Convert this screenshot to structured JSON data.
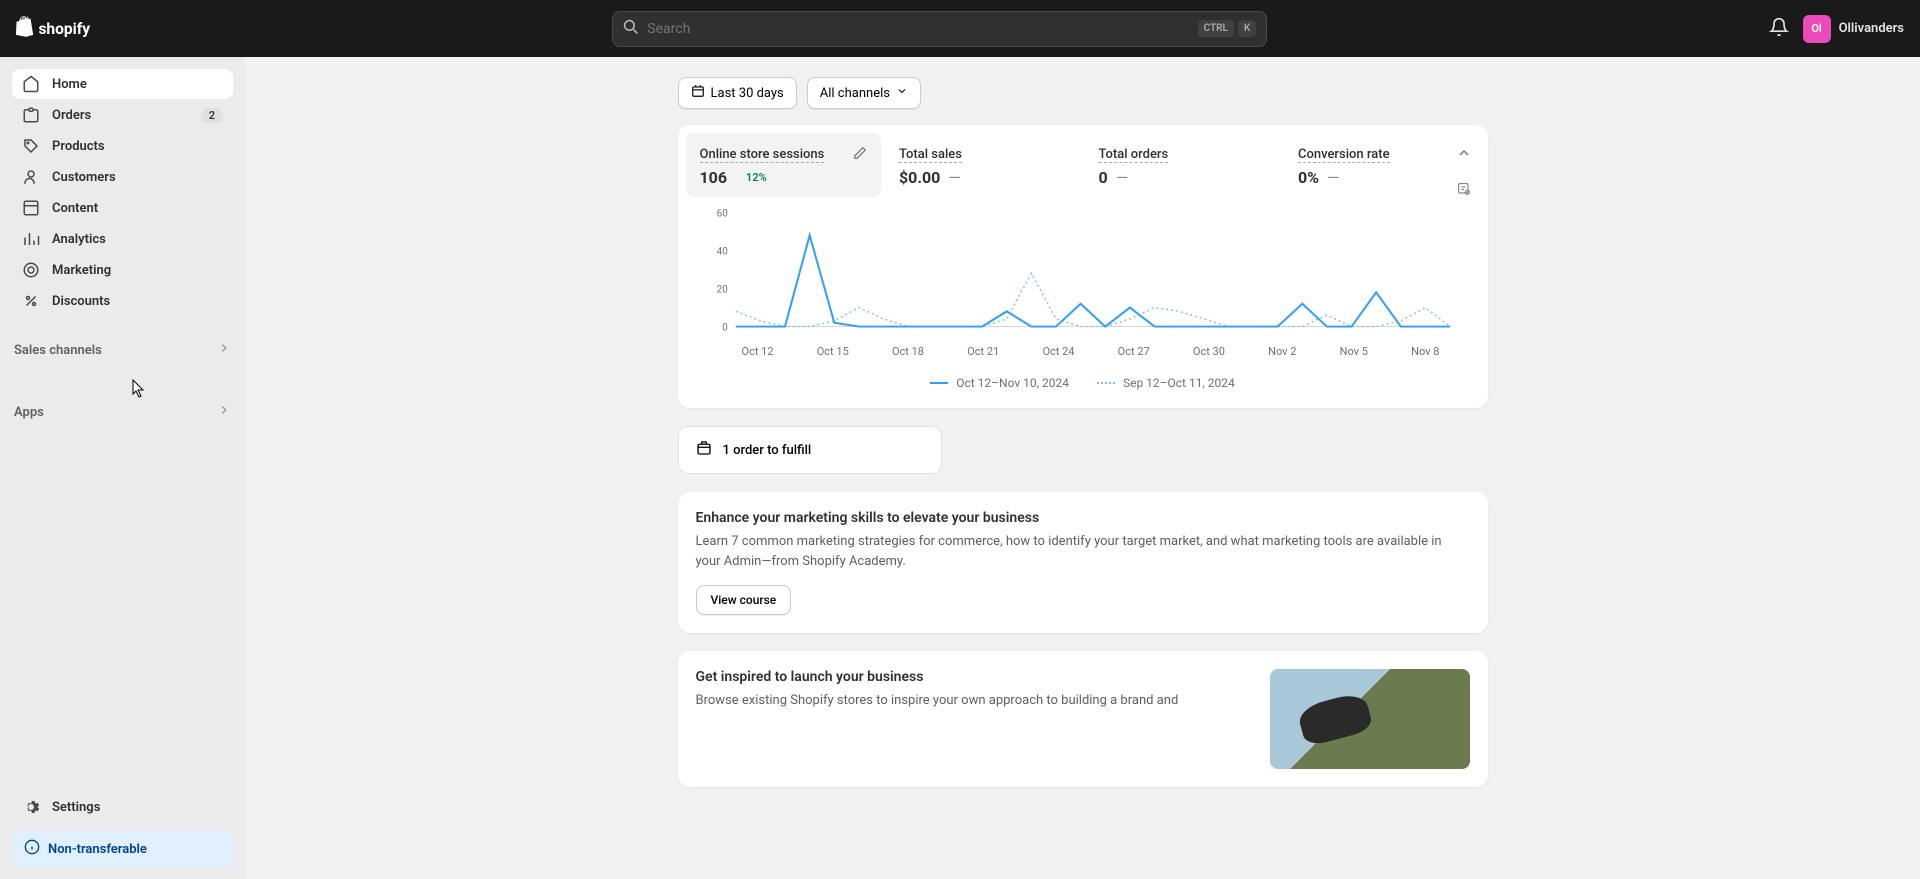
{
  "header": {
    "search_placeholder": "Search",
    "kbd1": "CTRL",
    "kbd2": "K",
    "avatar_initials": "Ol",
    "user_name": "Ollivanders"
  },
  "sidebar": {
    "items": [
      {
        "label": "Home"
      },
      {
        "label": "Orders",
        "badge": "2"
      },
      {
        "label": "Products"
      },
      {
        "label": "Customers"
      },
      {
        "label": "Content"
      },
      {
        "label": "Analytics"
      },
      {
        "label": "Marketing"
      },
      {
        "label": "Discounts"
      }
    ],
    "sales_channels_label": "Sales channels",
    "apps_label": "Apps",
    "settings_label": "Settings",
    "non_transferable_label": "Non-transferable"
  },
  "filters": {
    "date_label": "Last 30 days",
    "channels_label": "All channels"
  },
  "metrics": [
    {
      "label": "Online store sessions",
      "value": "106",
      "delta": "12%"
    },
    {
      "label": "Total sales",
      "value": "$0.00",
      "delta": "—"
    },
    {
      "label": "Total orders",
      "value": "0",
      "delta": "—"
    },
    {
      "label": "Conversion rate",
      "value": "0%",
      "delta": "—"
    }
  ],
  "chart_data": {
    "type": "line",
    "ylim": [
      0,
      60
    ],
    "y_ticks": [
      "60",
      "40",
      "20",
      "0"
    ],
    "x_ticks": [
      "Oct 12",
      "Oct 15",
      "Oct 18",
      "Oct 21",
      "Oct 24",
      "Oct 27",
      "Oct 30",
      "Nov 2",
      "Nov 5",
      "Nov 8"
    ],
    "series": [
      {
        "name": "Oct 12–Nov 10, 2024",
        "style": "solid",
        "color": "#2c9fff",
        "x": [
          "Oct 12",
          "Oct 13",
          "Oct 14",
          "Oct 15",
          "Oct 16",
          "Oct 17",
          "Oct 18",
          "Oct 19",
          "Oct 20",
          "Oct 21",
          "Oct 22",
          "Oct 23",
          "Oct 24",
          "Oct 25",
          "Oct 26",
          "Oct 27",
          "Oct 28",
          "Oct 29",
          "Oct 30",
          "Oct 31",
          "Nov 1",
          "Nov 2",
          "Nov 3",
          "Nov 4",
          "Nov 5",
          "Nov 6",
          "Nov 7",
          "Nov 8",
          "Nov 9",
          "Nov 10"
        ],
        "values": [
          0,
          0,
          0,
          48,
          2,
          0,
          0,
          0,
          0,
          0,
          0,
          8,
          0,
          0,
          12,
          0,
          10,
          0,
          0,
          0,
          0,
          0,
          0,
          12,
          0,
          0,
          18,
          0,
          0,
          0
        ]
      },
      {
        "name": "Sep 12–Oct 11, 2024",
        "style": "dotted",
        "color": "#80bfff",
        "x": [
          "Sep 12",
          "Sep 13",
          "Sep 14",
          "Sep 15",
          "Sep 16",
          "Sep 17",
          "Sep 18",
          "Sep 19",
          "Sep 20",
          "Sep 21",
          "Sep 22",
          "Sep 23",
          "Sep 24",
          "Sep 25",
          "Sep 26",
          "Sep 27",
          "Sep 28",
          "Sep 29",
          "Sep 30",
          "Oct 1",
          "Oct 2",
          "Oct 3",
          "Oct 4",
          "Oct 5",
          "Oct 6",
          "Oct 7",
          "Oct 8",
          "Oct 9",
          "Oct 10",
          "Oct 11"
        ],
        "values": [
          8,
          3,
          0,
          0,
          3,
          10,
          4,
          0,
          0,
          0,
          0,
          4,
          28,
          4,
          0,
          0,
          4,
          10,
          8,
          4,
          0,
          0,
          0,
          0,
          6,
          0,
          0,
          3,
          10,
          0
        ]
      }
    ],
    "legend": [
      "Oct 12–Nov 10, 2024",
      "Sep 12–Oct 11, 2024"
    ]
  },
  "fulfill": {
    "label": "1 order to fulfill"
  },
  "marketing_card": {
    "title": "Enhance your marketing skills to elevate your business",
    "body": "Learn 7 common marketing strategies for commerce, how to identify your target market, and what marketing tools are available in your Admin—from Shopify Academy.",
    "button": "View course"
  },
  "inspire_card": {
    "title": "Get inspired to launch your business",
    "body": "Browse existing Shopify stores to inspire your own approach to building a brand and"
  }
}
